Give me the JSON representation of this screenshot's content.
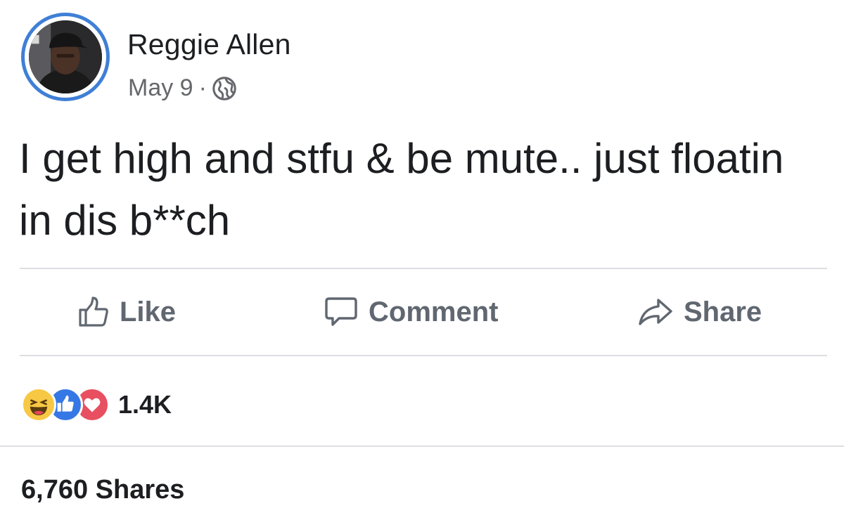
{
  "post": {
    "author_name": "Reggie Allen",
    "date": "May 9",
    "separator": "·",
    "visibility_icon": "globe-icon",
    "text": "I get high and stfu & be mute.. just floatin in dis b**ch"
  },
  "actions": {
    "like_label": "Like",
    "comment_label": "Comment",
    "share_label": "Share"
  },
  "reactions": {
    "icons": [
      "haha-reaction-icon",
      "like-reaction-icon",
      "love-reaction-icon"
    ],
    "count": "1.4K"
  },
  "shares": {
    "label": "6,760 Shares"
  },
  "colors": {
    "avatar_ring": "#3f7fd6",
    "action_gray": "#606770",
    "meta_gray": "#65676b",
    "haha_yellow": "#f7c843",
    "like_blue": "#3578e5",
    "love_red": "#e84f60"
  }
}
